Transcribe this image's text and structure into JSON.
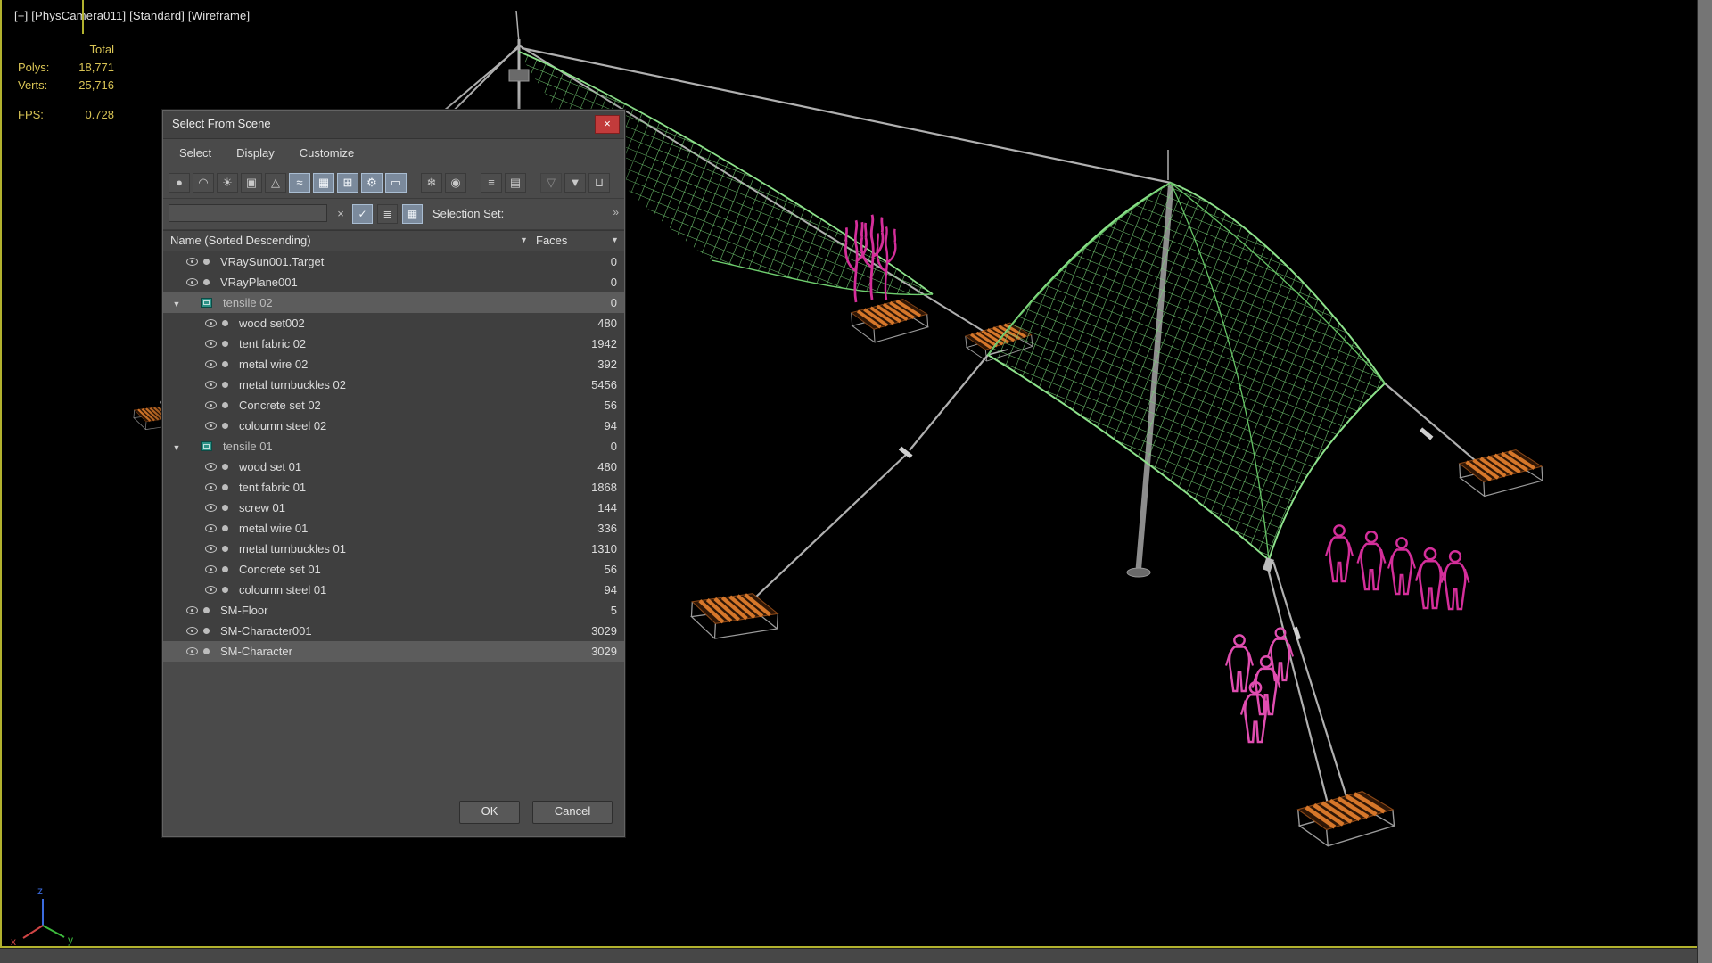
{
  "viewport": {
    "label": "[+]  [PhysCamera011]  [Standard]  [Wireframe]",
    "stats": {
      "total_label": "Total",
      "polys_label": "Polys:",
      "polys": "18,771",
      "verts_label": "Verts:",
      "verts": "25,716",
      "fps_label": "FPS:",
      "fps": "0.728"
    },
    "axis": {
      "x": "x",
      "y": "y",
      "z": "z"
    }
  },
  "dialog": {
    "title": "Select From Scene",
    "close_glyph": "×",
    "menus": [
      "Select",
      "Display",
      "Customize"
    ],
    "toolbar": [
      {
        "name": "display-geometry-icon",
        "glyph": "●"
      },
      {
        "name": "display-shapes-icon",
        "glyph": "◠"
      },
      {
        "name": "display-lights-icon",
        "glyph": "☀"
      },
      {
        "name": "display-cameras-icon",
        "glyph": "▣"
      },
      {
        "name": "display-helpers-icon",
        "glyph": "△"
      },
      {
        "name": "display-space-warps-icon",
        "glyph": "≈",
        "active": true
      },
      {
        "name": "display-groups-icon",
        "glyph": "▦",
        "active": true
      },
      {
        "name": "display-xrefs-icon",
        "glyph": "⊞",
        "active": true
      },
      {
        "name": "display-bones-icon",
        "glyph": "⚙",
        "active": true
      },
      {
        "name": "display-containers-icon",
        "glyph": "▭",
        "active": true
      },
      {
        "name": "display-frozen-icon",
        "glyph": "❄",
        "gap": true
      },
      {
        "name": "display-hidden-icon",
        "glyph": "◉"
      },
      {
        "name": "view-list-icon",
        "glyph": "≡",
        "gap": true
      },
      {
        "name": "view-columns-icon",
        "glyph": "▤"
      },
      {
        "name": "filter-sets-icon",
        "glyph": "▽",
        "gap": true,
        "disabled": true
      },
      {
        "name": "filter-icon",
        "glyph": "▼"
      },
      {
        "name": "container-bin-icon",
        "glyph": "⊔"
      }
    ],
    "search": {
      "value": "",
      "clear_glyph": "×",
      "filter_check_glyph": "✓",
      "layers_glyph": "≣",
      "selection_window_glyph": "▦",
      "selection_set_label": "Selection Set:",
      "overflow_glyph": "»"
    },
    "columns": {
      "name": "Name (Sorted Descending)",
      "faces": "Faces"
    },
    "rows": [
      {
        "kind": "object",
        "level": 0,
        "name": "VRaySun001.Target",
        "faces": "0"
      },
      {
        "kind": "object",
        "level": 0,
        "name": "VRayPlane001",
        "faces": "0"
      },
      {
        "kind": "group",
        "level": 0,
        "name": "tensile 02",
        "faces": "0",
        "selected": true,
        "expanded": true
      },
      {
        "kind": "object",
        "level": 1,
        "name": "wood set002",
        "faces": "480"
      },
      {
        "kind": "object",
        "level": 1,
        "name": "tent fabric 02",
        "faces": "1942"
      },
      {
        "kind": "object",
        "level": 1,
        "name": "metal wire 02",
        "faces": "392"
      },
      {
        "kind": "object",
        "level": 1,
        "name": "metal turnbuckles 02",
        "faces": "5456"
      },
      {
        "kind": "object",
        "level": 1,
        "name": "Concrete set 02",
        "faces": "56"
      },
      {
        "kind": "object",
        "level": 1,
        "name": "coloumn steel 02",
        "faces": "94"
      },
      {
        "kind": "group",
        "level": 0,
        "name": "tensile 01",
        "faces": "0",
        "expanded": true
      },
      {
        "kind": "object",
        "level": 1,
        "name": "wood set 01",
        "faces": "480"
      },
      {
        "kind": "object",
        "level": 1,
        "name": "tent fabric 01",
        "faces": "1868"
      },
      {
        "kind": "object",
        "level": 1,
        "name": "screw 01",
        "faces": "144"
      },
      {
        "kind": "object",
        "level": 1,
        "name": "metal wire 01",
        "faces": "336"
      },
      {
        "kind": "object",
        "level": 1,
        "name": "metal turnbuckles 01",
        "faces": "1310"
      },
      {
        "kind": "object",
        "level": 1,
        "name": "Concrete set 01",
        "faces": "56"
      },
      {
        "kind": "object",
        "level": 1,
        "name": "coloumn steel 01",
        "faces": "94"
      },
      {
        "kind": "object",
        "level": 0,
        "name": "SM-Floor",
        "faces": "5"
      },
      {
        "kind": "object",
        "level": 0,
        "name": "SM-Character001",
        "faces": "3029"
      },
      {
        "kind": "object",
        "level": 0,
        "name": "SM-Character",
        "faces": "3029",
        "selected": true
      }
    ],
    "buttons": {
      "ok": "OK",
      "cancel": "Cancel"
    }
  },
  "colors": {
    "mesh_green": "#84dc84",
    "people_magenta": "#d42e9a",
    "platform_orange": "#d6772a",
    "stats_yellow": "#d9c455",
    "selection_gray": "#5c5c5c",
    "close_red": "#c23b3b",
    "viewport_border_yellow": "#b2b22e"
  }
}
